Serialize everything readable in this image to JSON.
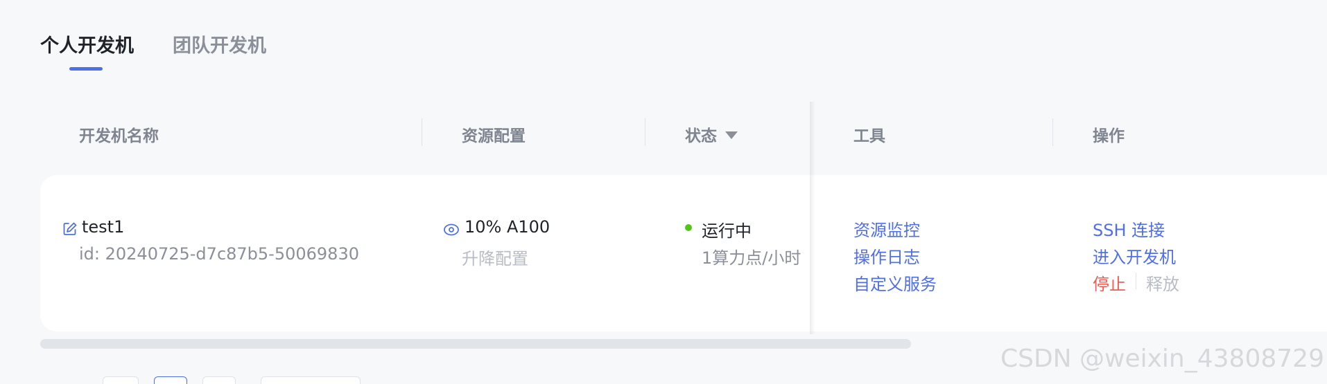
{
  "tabs": [
    {
      "label": "个人开发机",
      "active": true
    },
    {
      "label": "团队开发机",
      "active": false
    }
  ],
  "table": {
    "headers": {
      "name": "开发机名称",
      "resource": "资源配置",
      "status": "状态",
      "tools": "工具",
      "actions": "操作"
    },
    "rows": [
      {
        "name": "test1",
        "id": "id: 20240725-d7c87b5-50069830",
        "resource": "10% A100",
        "resource_action": "升降配置",
        "status": "运行中",
        "status_color": "#52c41a",
        "billing": "1算力点/小时",
        "tools": [
          "资源监控",
          "操作日志",
          "自定义服务"
        ],
        "actions": {
          "ssh": "SSH 连接",
          "enter": "进入开发机",
          "stop": "停止",
          "release": "释放"
        }
      }
    ]
  },
  "colors": {
    "accent": "#4f6fe8",
    "danger": "#f05a50",
    "running": "#52c41a"
  },
  "watermark": "CSDN @weixin_43808729"
}
